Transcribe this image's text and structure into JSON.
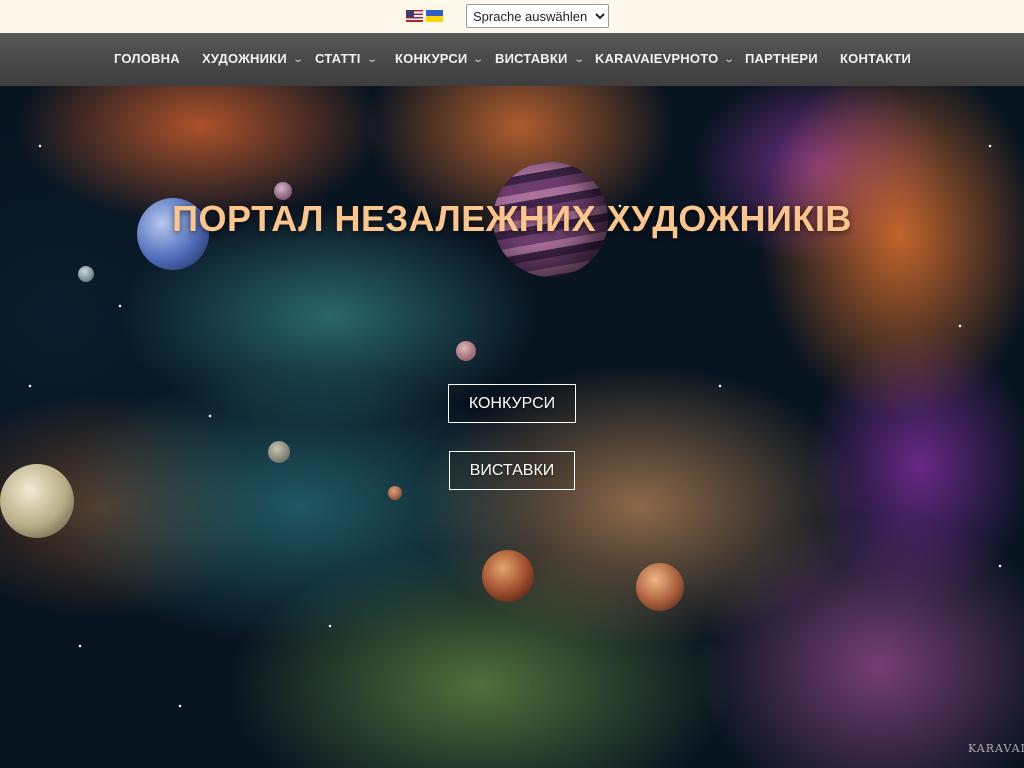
{
  "topbar": {
    "flags": [
      {
        "name": "us-flag-icon",
        "language": "English"
      },
      {
        "name": "ua-flag-icon",
        "language": "Українська"
      }
    ],
    "language_select": {
      "selected": "Sprache auswählen",
      "options": [
        "Sprache auswählen"
      ]
    }
  },
  "nav": {
    "items": [
      {
        "label": "ГОЛОВНА",
        "has_dropdown": false
      },
      {
        "label": "ХУДОЖНИКИ",
        "has_dropdown": true
      },
      {
        "label": "СТАТТІ",
        "has_dropdown": true
      },
      {
        "label": "КОНКУРСИ",
        "has_dropdown": true
      },
      {
        "label": "ВИСТАВКИ",
        "has_dropdown": true
      },
      {
        "label": "KARAVAIEVPHOTO",
        "has_dropdown": true
      },
      {
        "label": "ПАРТНЕРИ",
        "has_dropdown": false
      },
      {
        "label": "КОНТАКТИ",
        "has_dropdown": false
      }
    ],
    "chevron_glyph": "⌄"
  },
  "hero": {
    "title": "ПОРТАЛ НЕЗАЛЕЖНИХ ХУДОЖНИКІВ",
    "buttons": {
      "contests": "КОНКУРСИ",
      "exhibitions": "ВИСТАВКИ"
    },
    "signature": "KARAVAIE"
  },
  "colors": {
    "topbar_bg": "#fef8ea",
    "nav_bg": "#4a4a4a",
    "nav_text": "#f2f2f2",
    "title_color": "#fbc58c",
    "button_border": "#ffffff"
  }
}
